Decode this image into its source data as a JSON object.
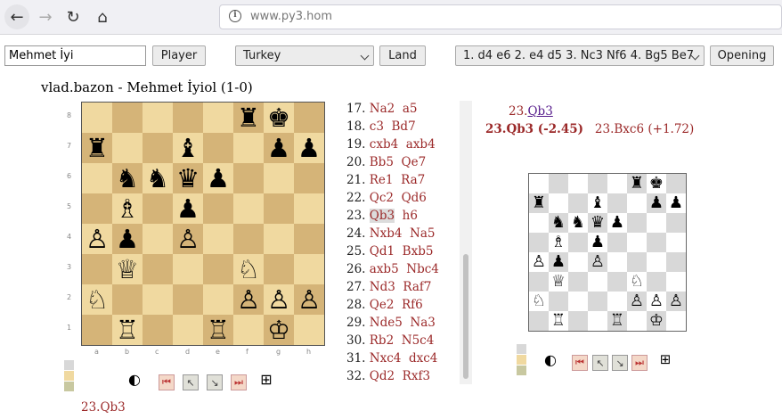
{
  "browser": {
    "url": "www.py3.hom",
    "back_icon": "←",
    "forward_icon": "→",
    "reload_icon": "↻",
    "home_icon": "⌂",
    "info_icon": "i"
  },
  "toolbar": {
    "player_value": "Mehmet İyi",
    "player_button": "Player",
    "country_value": "Turkey",
    "land_button": "Land",
    "opening_value": "1. d4 e6 2. e4 d5 3. Nc3 Nf6 4. Bg5 Be7",
    "opening_button": "Opening"
  },
  "game": {
    "title": "vlad.bazon - Mehmet İyiol (1-0)"
  },
  "board": {
    "light": "#f0d9a0",
    "dark": "#d5b478",
    "files": [
      "a",
      "b",
      "c",
      "d",
      "e",
      "f",
      "g",
      "h"
    ],
    "ranks": [
      "8",
      "7",
      "6",
      "5",
      "4",
      "3",
      "2",
      "1"
    ],
    "position": [
      [
        "",
        "",
        "",
        "",
        "",
        "r",
        "k",
        ""
      ],
      [
        "r",
        "",
        "",
        "b",
        "",
        "",
        "p",
        "p"
      ],
      [
        "",
        "n",
        "n",
        "q",
        "p",
        "",
        "",
        ""
      ],
      [
        "",
        "B",
        "",
        "p",
        "",
        "",
        "",
        ""
      ],
      [
        "P",
        "p",
        "",
        "P",
        "",
        "",
        "",
        ""
      ],
      [
        "",
        "Q",
        "",
        "",
        "",
        "N",
        "",
        ""
      ],
      [
        "N",
        "",
        "",
        "",
        "",
        "P",
        "P",
        "P"
      ],
      [
        "",
        "R",
        "",
        "",
        "R",
        "",
        "K",
        ""
      ]
    ]
  },
  "mini_board": {
    "light": "#ffffff",
    "dark": "#d8d8d8"
  },
  "swatches": [
    "#d8d8d8",
    "#f0d9a0",
    "#c8c8a0"
  ],
  "controls": {
    "flip_icon": "◐",
    "first_icon": "⏮",
    "prev_icon": "↖",
    "next_icon": "↘",
    "last_icon": "⏭",
    "grid_icon": "⊞"
  },
  "moves": [
    {
      "num": "17.",
      "white": "Na2",
      "black": "a5"
    },
    {
      "num": "18.",
      "white": "c3",
      "black": "Bd7"
    },
    {
      "num": "19.",
      "white": "cxb4",
      "black": "axb4"
    },
    {
      "num": "20.",
      "white": "Bb5",
      "black": "Qe7"
    },
    {
      "num": "21.",
      "white": "Re1",
      "black": "Ra7"
    },
    {
      "num": "22.",
      "white": "Qc2",
      "black": "Qd6"
    },
    {
      "num": "23.",
      "white": "Qb3",
      "black": "h6"
    },
    {
      "num": "24.",
      "white": "Nxb4",
      "black": "Na5"
    },
    {
      "num": "25.",
      "white": "Qd1",
      "black": "Bxb5"
    },
    {
      "num": "26.",
      "white": "axb5",
      "black": "Nbc4"
    },
    {
      "num": "27.",
      "white": "Nd3",
      "black": "Raf7"
    },
    {
      "num": "28.",
      "white": "Qe2",
      "black": "Rf6"
    },
    {
      "num": "29.",
      "white": "Nde5",
      "black": "Na3"
    },
    {
      "num": "30.",
      "white": "Rb2",
      "black": "N5c4"
    },
    {
      "num": "31.",
      "white": "Nxc4",
      "black": "dxc4"
    },
    {
      "num": "32.",
      "white": "Qd2",
      "black": "Rxf3"
    }
  ],
  "selected_move": "Qb3",
  "analysis": {
    "move_prefix": "23.",
    "move_link": "Qb3",
    "best_line": "23.Qb3 (-2.45)",
    "alt_line": "23.Bxc6 (+1.72)"
  },
  "bottom_move": "23.Qb3"
}
